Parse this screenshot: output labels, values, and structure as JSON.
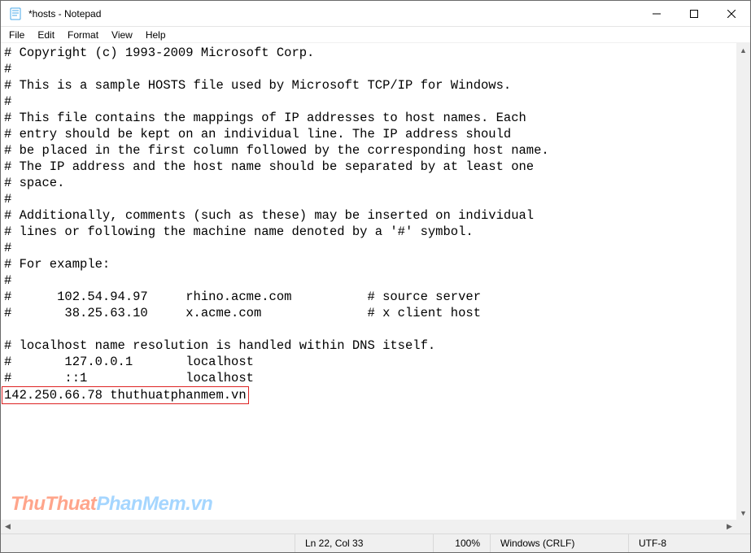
{
  "window": {
    "title": "*hosts - Notepad"
  },
  "menubar": {
    "items": [
      "File",
      "Edit",
      "Format",
      "View",
      "Help"
    ]
  },
  "editor": {
    "lines": [
      "# Copyright (c) 1993-2009 Microsoft Corp.",
      "#",
      "# This is a sample HOSTS file used by Microsoft TCP/IP for Windows.",
      "#",
      "# This file contains the mappings of IP addresses to host names. Each",
      "# entry should be kept on an individual line. The IP address should",
      "# be placed in the first column followed by the corresponding host name.",
      "# The IP address and the host name should be separated by at least one",
      "# space.",
      "#",
      "# Additionally, comments (such as these) may be inserted on individual",
      "# lines or following the machine name denoted by a '#' symbol.",
      "#",
      "# For example:",
      "#",
      "#      102.54.94.97     rhino.acme.com          # source server",
      "#       38.25.63.10     x.acme.com              # x client host",
      "",
      "# localhost name resolution is handled within DNS itself.",
      "#       127.0.0.1       localhost",
      "#       ::1             localhost"
    ],
    "highlighted_line": "142.250.66.78 thuthuatphanmem.vn"
  },
  "statusbar": {
    "position": "Ln 22, Col 33",
    "zoom": "100%",
    "line_ending": "Windows (CRLF)",
    "encoding": "UTF-8"
  },
  "watermark": {
    "part1": "ThuThuat",
    "part2": "PhanMem.vn"
  }
}
